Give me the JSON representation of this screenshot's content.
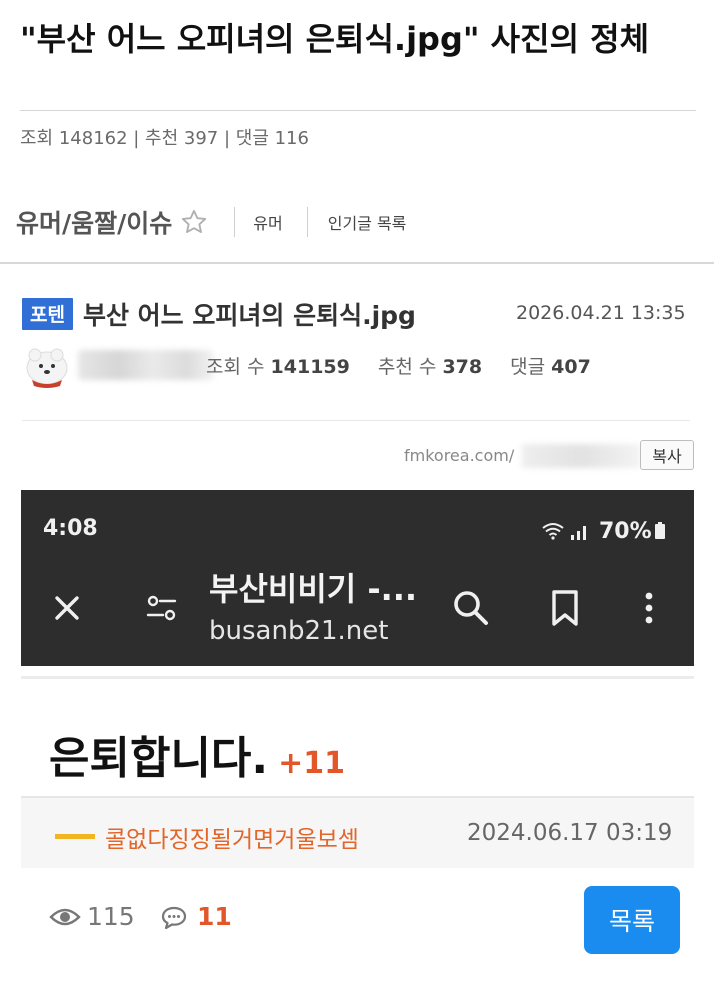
{
  "article": {
    "title": "\"부산 어느 오피녀의 은퇴식.jpg\" 사진의 정체",
    "stats": "조회 148162 | 추천 397 | 댓글 116"
  },
  "board": {
    "name": "유머/움짤/이슈",
    "links": [
      "유머",
      "인기글 목록"
    ]
  },
  "post": {
    "badge": "포텐",
    "title": "부산 어느 오피녀의 은퇴식.jpg",
    "date": "2026.04.21 13:35",
    "views_label": "조회 수",
    "views": "141159",
    "recommend_label": "추천 수",
    "recommend": "378",
    "comments_label": "댓글",
    "comments": "407",
    "url": "fmkorea.com/",
    "copy_label": "복사"
  },
  "embedded": {
    "status_time": "4:08",
    "battery": "70%",
    "site_title": "부산비비기 -...",
    "site_url": "busanb21.net",
    "headline": "은퇴합니다.",
    "headline_count": "+11",
    "nickname": "콜없다징징될거면거울보셈",
    "reply_date": "2024.06.17 03:19",
    "views": "115",
    "comments": "11",
    "list_button": "목록"
  },
  "colors": {
    "badge_blue": "#2f6fd6",
    "accent_orange": "#e2562a",
    "button_blue": "#1a8cf0",
    "phone_bar": "#2d2d2d"
  }
}
